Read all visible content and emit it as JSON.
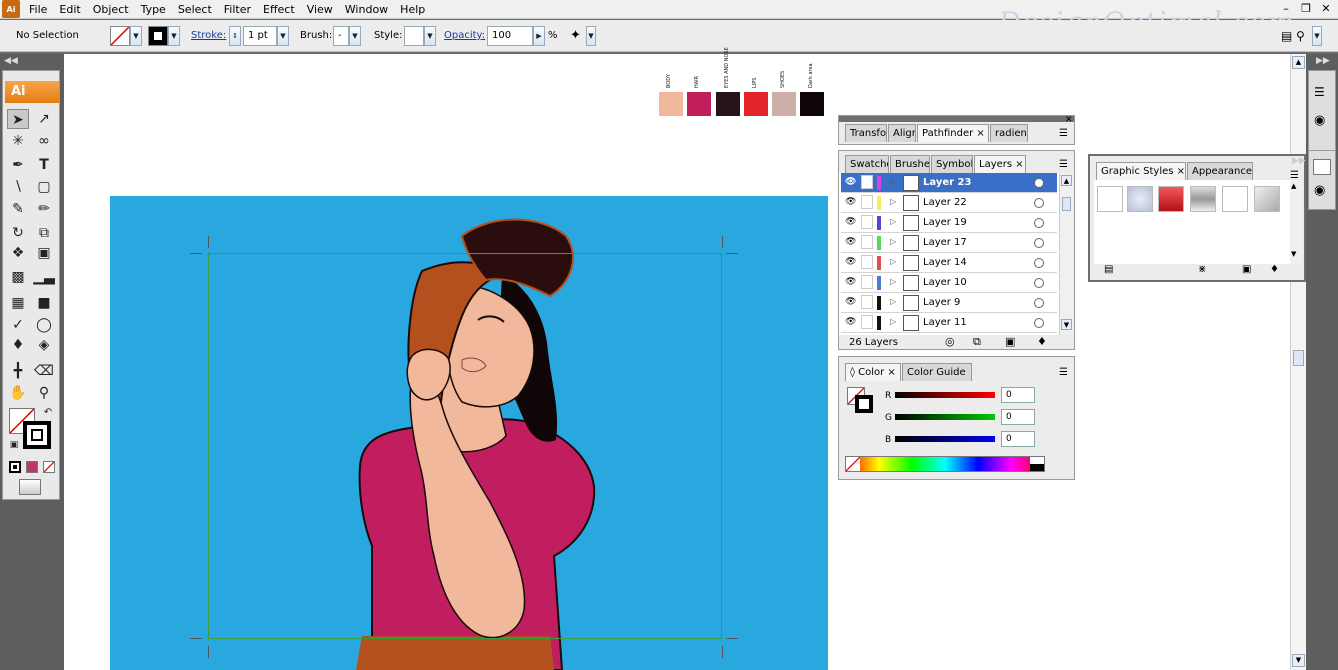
{
  "menu": [
    "File",
    "Edit",
    "Object",
    "Type",
    "Select",
    "Filter",
    "Effect",
    "View",
    "Window",
    "Help"
  ],
  "watermark": "DesignOptimal.com",
  "control": {
    "selection": "No Selection",
    "stroke_label": "Stroke:",
    "stroke_value": "1 pt",
    "brush_label": "Brush:",
    "brush_value": "-",
    "style_label": "Style:",
    "opacity_label": "Opacity:",
    "opacity_value": "100",
    "percent": "%"
  },
  "tools_header": "Ai",
  "color_refs": [
    {
      "label": "BODY",
      "color": "#f2b89b"
    },
    {
      "label": "HAIR",
      "color": "#c11e5c"
    },
    {
      "label": "EYES AND NOSE",
      "color": "#25151a"
    },
    {
      "label": "LIPS",
      "color": "#e2262a"
    },
    {
      "label": "SHOES",
      "color": "#cdafaa"
    },
    {
      "label": "Dark area",
      "color": "#100507"
    }
  ],
  "panel_top": {
    "tabs": [
      "Transfo",
      "Align",
      "Pathfinder",
      "radient"
    ],
    "active": "Pathfinder"
  },
  "layers_panel": {
    "tabs": [
      "Swatche",
      "Brushes",
      "Symbols",
      "Layers"
    ],
    "active": "Layers",
    "layers": [
      {
        "name": "Layer 23",
        "color": "#e040e0",
        "selected": true
      },
      {
        "name": "Layer 22",
        "color": "#f5f05a",
        "selected": false
      },
      {
        "name": "Layer 19",
        "color": "#4b4bd6",
        "selected": false
      },
      {
        "name": "Layer 17",
        "color": "#55d860",
        "selected": false
      },
      {
        "name": "Layer 14",
        "color": "#e05050",
        "selected": false
      },
      {
        "name": "Layer 10",
        "color": "#4a7ad8",
        "selected": false
      },
      {
        "name": "Layer 9",
        "color": "#111111",
        "selected": false
      },
      {
        "name": "Layer 11",
        "color": "#111111",
        "selected": false
      }
    ],
    "count": "26 Layers"
  },
  "color_panel": {
    "tabs": [
      "Color",
      "Color Guide"
    ],
    "active": "Color",
    "channels": [
      {
        "label": "R",
        "value": "0"
      },
      {
        "label": "G",
        "value": "0"
      },
      {
        "label": "B",
        "value": "0"
      }
    ]
  },
  "graphic_styles": {
    "tabs": [
      "Graphic Styles",
      "Appearance"
    ],
    "active": "Graphic Styles"
  }
}
